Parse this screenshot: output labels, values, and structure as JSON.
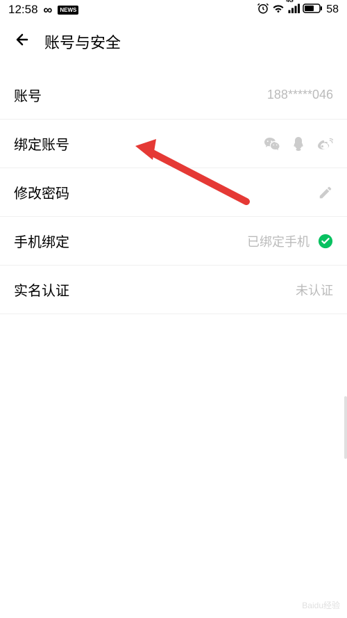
{
  "status_bar": {
    "time": "12:58",
    "battery": "58"
  },
  "header": {
    "title": "账号与安全"
  },
  "settings": {
    "account": {
      "label": "账号",
      "value": "188*****046"
    },
    "bind_account": {
      "label": "绑定账号"
    },
    "change_password": {
      "label": "修改密码"
    },
    "phone_bind": {
      "label": "手机绑定",
      "value": "已绑定手机"
    },
    "real_name": {
      "label": "实名认证",
      "value": "未认证"
    }
  },
  "watermark": "Baidu经验"
}
